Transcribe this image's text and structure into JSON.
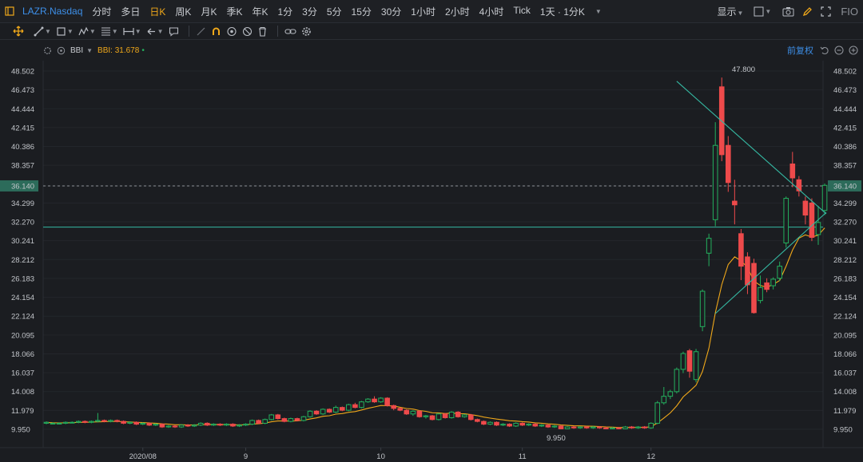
{
  "topbar": {
    "symbol": "LAZR.Nasdaq",
    "timeframes": [
      "分时",
      "多日",
      "日K",
      "周K",
      "月K",
      "季K",
      "年K",
      "1分",
      "3分",
      "5分",
      "15分",
      "30分",
      "1小时",
      "2小时",
      "4小时",
      "Tick",
      "1天 · 1分K"
    ],
    "active_timeframe": "日K",
    "display_label": "显示",
    "fio_label": "FIO"
  },
  "indicator": {
    "name": "BBI",
    "value_text": "BBI: 31.678",
    "adjust_label": "前复权"
  },
  "colors": {
    "up": "#24b05e",
    "down": "#ee4a4b",
    "bbi": "#f0a81a",
    "trendline": "#35b8a2",
    "price_tag": "#2c6b5a"
  },
  "chart_data": {
    "type": "candlestick",
    "y_ticks": [
      "48.502",
      "46.473",
      "44.444",
      "42.415",
      "40.386",
      "38.357",
      "36.140",
      "34.299",
      "32.270",
      "30.241",
      "28.212",
      "26.183",
      "24.154",
      "22.124",
      "20.095",
      "18.066",
      "16.037",
      "14.008",
      "11.979",
      "9.950"
    ],
    "y_range": [
      9.95,
      48.502
    ],
    "x_labels": [
      "2020/08",
      "9",
      "10",
      "11",
      "12"
    ],
    "current_price": "36.140",
    "high_annotation": "47.800",
    "low_annotation": "9.950",
    "horizontal_line": 31.7,
    "trendlines": [
      {
        "from": [
          "2020-12-07",
          47.4
        ],
        "to": [
          "2021-01-08",
          33.9
        ]
      },
      {
        "from": [
          "2020-12-15",
          22.4
        ],
        "to": [
          "2021-01-08",
          32.5
        ]
      }
    ],
    "candles": [
      [
        "07-20",
        10.6,
        10.7,
        10.5,
        10.8
      ],
      [
        "07-21",
        10.6,
        10.6,
        10.5,
        10.7
      ],
      [
        "07-22",
        10.6,
        10.6,
        10.5,
        10.7
      ],
      [
        "07-23",
        10.6,
        10.7,
        10.5,
        10.8
      ],
      [
        "07-24",
        10.7,
        10.7,
        10.6,
        10.8
      ],
      [
        "07-27",
        10.7,
        10.8,
        10.6,
        10.9
      ],
      [
        "07-28",
        10.8,
        10.7,
        10.6,
        10.9
      ],
      [
        "07-29",
        10.7,
        10.8,
        10.6,
        10.9
      ],
      [
        "07-30",
        10.8,
        10.9,
        10.7,
        11.7
      ],
      [
        "07-31",
        10.9,
        10.8,
        10.7,
        11.0
      ],
      [
        "08-03",
        10.8,
        10.9,
        10.7,
        11.0
      ],
      [
        "08-04",
        10.9,
        10.8,
        10.7,
        11.0
      ],
      [
        "08-05",
        10.8,
        10.6,
        10.5,
        10.9
      ],
      [
        "08-06",
        10.6,
        10.7,
        10.5,
        10.8
      ],
      [
        "08-07",
        10.7,
        10.5,
        10.4,
        10.8
      ],
      [
        "08-10",
        10.5,
        10.6,
        10.4,
        10.7
      ],
      [
        "08-11",
        10.6,
        10.4,
        10.3,
        10.7
      ],
      [
        "08-12",
        10.4,
        10.5,
        10.3,
        10.6
      ],
      [
        "08-13",
        10.5,
        10.2,
        10.1,
        10.6
      ],
      [
        "08-14",
        10.2,
        10.3,
        10.1,
        10.4
      ],
      [
        "08-17",
        10.3,
        10.2,
        10.1,
        10.4
      ],
      [
        "08-18",
        10.2,
        10.4,
        10.1,
        10.5
      ],
      [
        "08-19",
        10.4,
        10.3,
        10.2,
        10.5
      ],
      [
        "08-20",
        10.3,
        10.4,
        10.2,
        10.5
      ],
      [
        "08-21",
        10.4,
        10.6,
        10.3,
        10.7
      ],
      [
        "08-24",
        10.6,
        10.4,
        10.3,
        10.7
      ],
      [
        "08-25",
        10.4,
        10.5,
        10.3,
        10.6
      ],
      [
        "08-26",
        10.5,
        10.4,
        10.3,
        10.6
      ],
      [
        "08-27",
        10.4,
        10.5,
        10.3,
        10.6
      ],
      [
        "08-28",
        10.5,
        10.3,
        10.2,
        10.6
      ],
      [
        "08-31",
        10.3,
        10.4,
        10.2,
        10.5
      ],
      [
        "09-01",
        10.4,
        10.5,
        10.3,
        10.6
      ],
      [
        "09-02",
        10.5,
        10.9,
        10.4,
        11.0
      ],
      [
        "09-03",
        10.9,
        10.6,
        10.5,
        11.0
      ],
      [
        "09-04",
        10.6,
        11.0,
        10.5,
        11.1
      ],
      [
        "09-08",
        11.0,
        11.5,
        10.9,
        11.6
      ],
      [
        "09-09",
        11.5,
        11.1,
        11.0,
        11.6
      ],
      [
        "09-10",
        11.1,
        10.8,
        10.7,
        11.2
      ],
      [
        "09-11",
        10.8,
        11.1,
        10.7,
        11.2
      ],
      [
        "09-14",
        11.1,
        10.9,
        10.8,
        11.2
      ],
      [
        "09-15",
        10.9,
        11.3,
        10.8,
        11.4
      ],
      [
        "09-16",
        11.3,
        11.9,
        11.2,
        12.0
      ],
      [
        "09-17",
        11.9,
        11.6,
        11.5,
        12.0
      ],
      [
        "09-18",
        11.6,
        12.1,
        11.5,
        12.2
      ],
      [
        "09-21",
        12.1,
        11.8,
        11.7,
        12.2
      ],
      [
        "09-22",
        11.8,
        12.3,
        11.7,
        12.5
      ],
      [
        "09-23",
        12.3,
        12.0,
        11.9,
        12.4
      ],
      [
        "09-24",
        12.0,
        12.6,
        11.9,
        12.7
      ],
      [
        "09-25",
        12.6,
        12.3,
        12.2,
        12.8
      ],
      [
        "09-28",
        12.3,
        12.9,
        12.2,
        13.0
      ],
      [
        "09-29",
        12.9,
        13.2,
        12.8,
        13.3
      ],
      [
        "09-30",
        13.2,
        12.9,
        12.8,
        13.5
      ],
      [
        "10-01",
        12.9,
        13.3,
        12.8,
        13.4
      ],
      [
        "10-02",
        13.3,
        12.5,
        12.4,
        13.4
      ],
      [
        "10-05",
        12.5,
        12.2,
        12.0,
        12.6
      ],
      [
        "10-06",
        12.2,
        12.0,
        11.9,
        12.3
      ],
      [
        "10-07",
        12.0,
        11.6,
        11.5,
        12.1
      ],
      [
        "10-08",
        11.6,
        11.9,
        11.4,
        12.0
      ],
      [
        "10-09",
        11.9,
        11.3,
        11.2,
        12.0
      ],
      [
        "10-12",
        11.3,
        11.4,
        11.1,
        11.5
      ],
      [
        "10-13",
        11.4,
        11.0,
        10.9,
        11.5
      ],
      [
        "10-14",
        11.0,
        11.6,
        10.9,
        11.7
      ],
      [
        "10-15",
        11.6,
        11.2,
        11.1,
        11.7
      ],
      [
        "10-16",
        11.2,
        11.8,
        11.1,
        11.9
      ],
      [
        "10-19",
        11.8,
        11.3,
        11.2,
        11.9
      ],
      [
        "10-20",
        11.3,
        11.5,
        11.2,
        11.6
      ],
      [
        "10-21",
        11.5,
        11.0,
        10.9,
        11.6
      ],
      [
        "10-22",
        11.0,
        10.8,
        10.7,
        11.1
      ],
      [
        "10-23",
        10.8,
        10.5,
        10.4,
        10.9
      ],
      [
        "10-26",
        10.5,
        10.7,
        10.4,
        10.8
      ],
      [
        "10-27",
        10.7,
        10.4,
        10.3,
        10.8
      ],
      [
        "10-28",
        10.4,
        10.5,
        10.3,
        10.6
      ],
      [
        "10-29",
        10.5,
        10.3,
        10.2,
        10.6
      ],
      [
        "10-30",
        10.3,
        10.6,
        10.2,
        10.7
      ],
      [
        "11-02",
        10.6,
        10.4,
        10.3,
        10.7
      ],
      [
        "11-03",
        10.4,
        10.5,
        10.3,
        10.6
      ],
      [
        "11-04",
        10.5,
        10.3,
        10.2,
        10.6
      ],
      [
        "11-05",
        10.3,
        10.4,
        10.2,
        10.5
      ],
      [
        "11-06",
        10.4,
        10.2,
        10.1,
        10.5
      ],
      [
        "11-09",
        10.2,
        10.3,
        10.1,
        10.4
      ],
      [
        "11-10",
        10.3,
        10.0,
        9.95,
        10.4
      ],
      [
        "11-11",
        10.0,
        10.2,
        9.95,
        10.3
      ],
      [
        "11-12",
        10.2,
        10.1,
        10.0,
        10.3
      ],
      [
        "11-13",
        10.1,
        10.2,
        10.0,
        10.3
      ],
      [
        "11-16",
        10.2,
        10.1,
        10.0,
        10.3
      ],
      [
        "11-17",
        10.1,
        10.2,
        10.0,
        10.3
      ],
      [
        "11-18",
        10.2,
        10.1,
        10.0,
        10.3
      ],
      [
        "11-19",
        10.1,
        10.0,
        9.95,
        10.2
      ],
      [
        "11-20",
        10.0,
        10.1,
        9.95,
        10.2
      ],
      [
        "11-23",
        10.1,
        10.0,
        9.95,
        10.2
      ],
      [
        "11-24",
        10.0,
        10.2,
        9.95,
        10.3
      ],
      [
        "11-25",
        10.2,
        10.1,
        10.0,
        10.3
      ],
      [
        "11-27",
        10.1,
        10.2,
        10.0,
        10.3
      ],
      [
        "11-30",
        10.2,
        10.1,
        10.0,
        10.3
      ],
      [
        "12-01",
        10.1,
        10.6,
        10.0,
        10.7
      ],
      [
        "12-02",
        10.6,
        12.8,
        10.5,
        13.0
      ],
      [
        "12-03",
        12.8,
        13.5,
        12.6,
        14.5
      ],
      [
        "12-04",
        13.5,
        14.0,
        13.2,
        14.2
      ],
      [
        "12-07",
        14.0,
        16.4,
        13.8,
        16.6
      ],
      [
        "12-08",
        16.4,
        18.1,
        16.0,
        18.3
      ],
      [
        "12-09",
        18.4,
        16.2,
        15.5,
        18.6
      ],
      [
        "12-10",
        15.3,
        18.3,
        15.0,
        18.6
      ],
      [
        "12-11",
        21.0,
        24.8,
        20.5,
        25.0
      ],
      [
        "12-14",
        28.9,
        30.5,
        27.5,
        31.0
      ],
      [
        "12-15",
        32.5,
        40.5,
        31.8,
        43.0
      ],
      [
        "12-16",
        46.8,
        39.5,
        38.8,
        47.8
      ],
      [
        "12-17",
        40.5,
        36.5,
        35.5,
        41.5
      ],
      [
        "12-18",
        34.5,
        34.1,
        32.0,
        36.8
      ],
      [
        "12-21",
        31.0,
        27.5,
        26.0,
        31.5
      ],
      [
        "12-22",
        28.5,
        25.5,
        24.5,
        29.0
      ],
      [
        "12-23",
        27.8,
        22.5,
        22.4,
        28.3
      ],
      [
        "12-24",
        23.8,
        25.2,
        23.5,
        26.5
      ],
      [
        "12-28",
        25.7,
        25.0,
        24.7,
        26.2
      ],
      [
        "12-29",
        25.4,
        26.1,
        25.0,
        26.3
      ],
      [
        "12-30",
        26.2,
        27.5,
        25.9,
        28.0
      ],
      [
        "12-31",
        30.0,
        34.8,
        29.5,
        35.0
      ],
      [
        "01-04",
        38.5,
        37.0,
        36.0,
        39.8
      ],
      [
        "01-05",
        36.8,
        35.6,
        35.0,
        37.2
      ],
      [
        "01-06",
        34.5,
        33.0,
        32.0,
        35.0
      ],
      [
        "01-07",
        34.3,
        30.6,
        30.2,
        34.8
      ],
      [
        "01-08",
        30.9,
        32.2,
        29.8,
        34.0
      ],
      [
        "01-11",
        33.5,
        36.2,
        33.0,
        36.4
      ]
    ]
  }
}
